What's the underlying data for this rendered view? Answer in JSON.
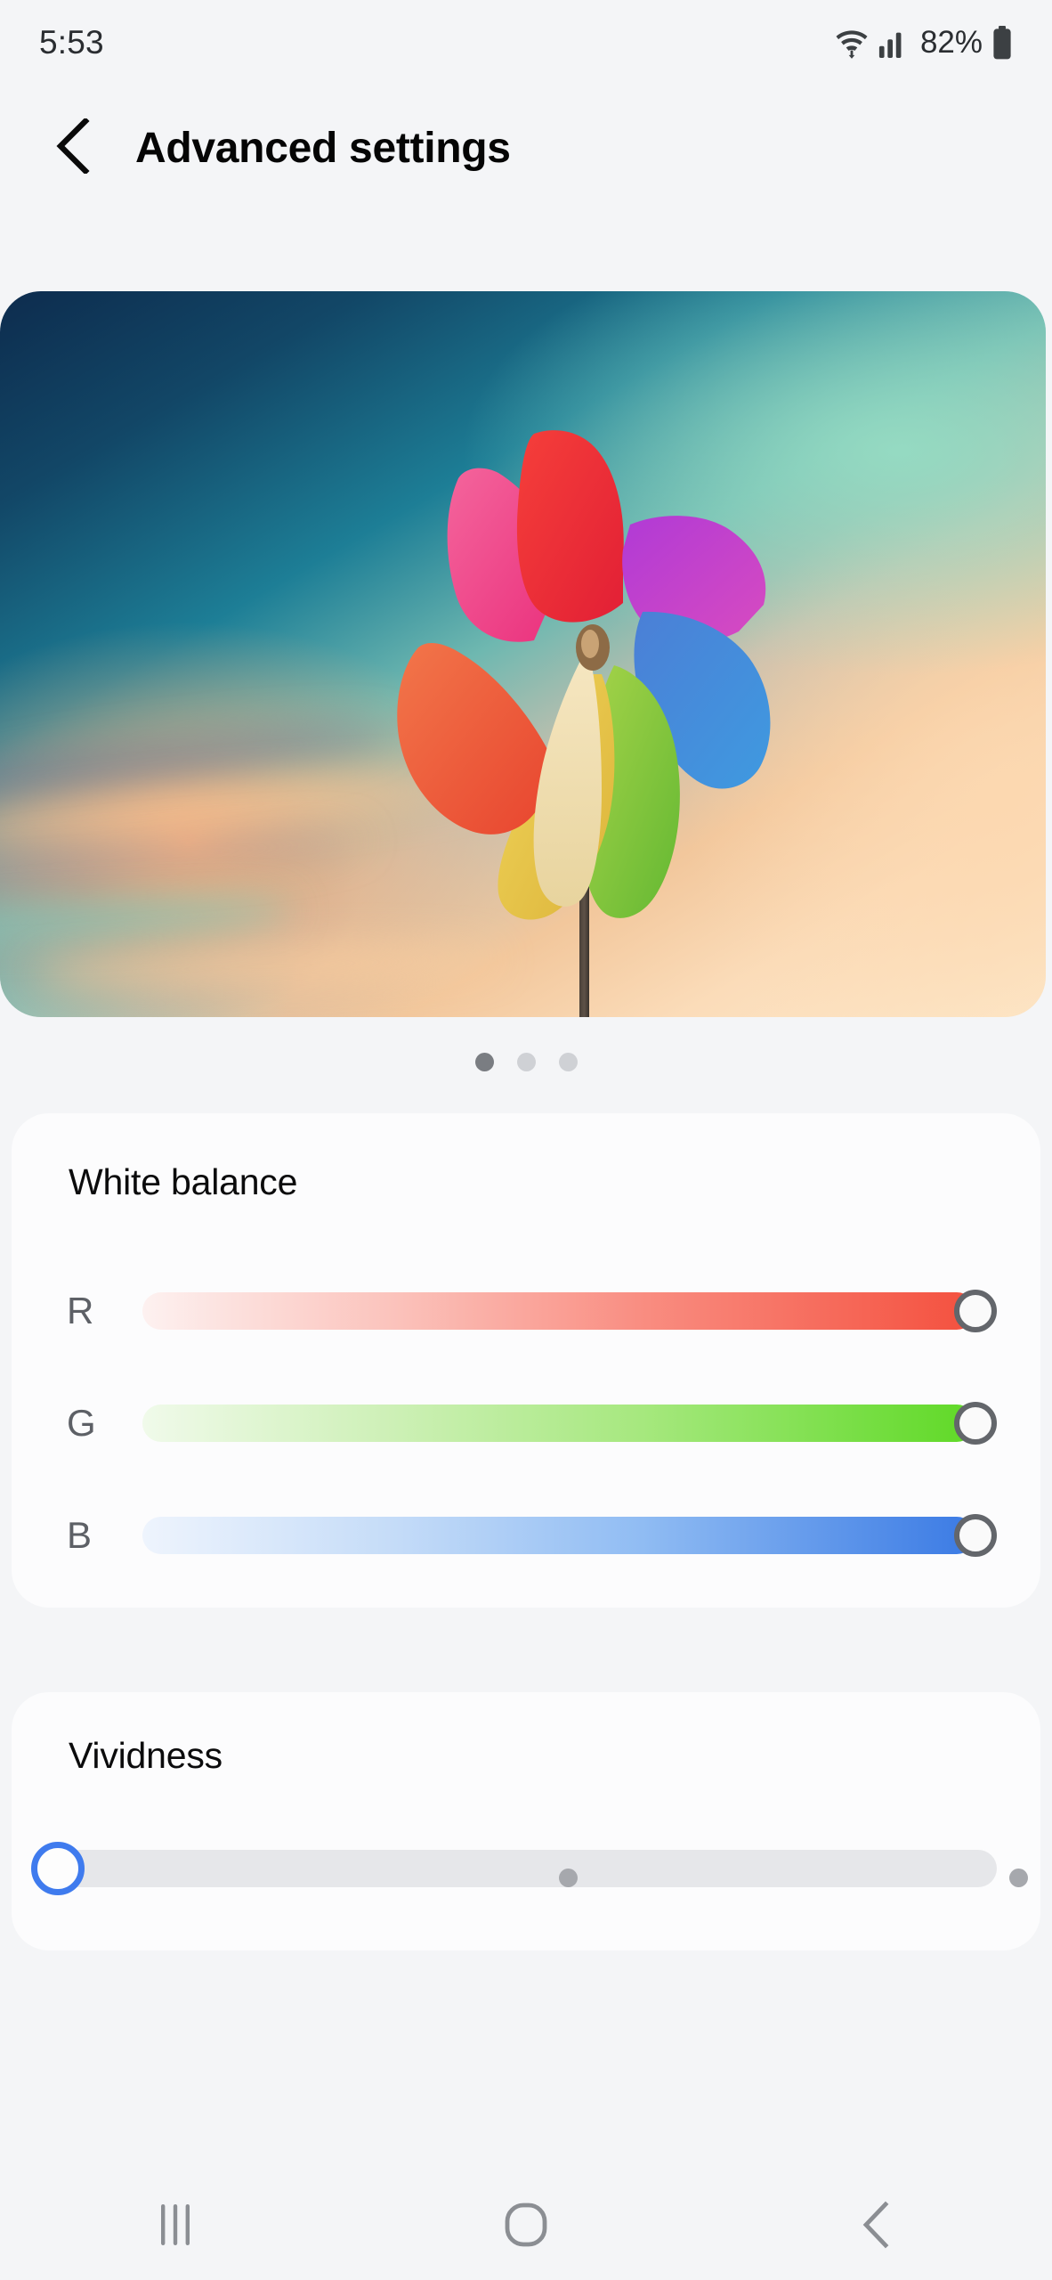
{
  "status_bar": {
    "time": "5:53",
    "battery_text": "82%",
    "icons": [
      "wifi-icon",
      "cellular-signal-icon",
      "battery-icon"
    ]
  },
  "header": {
    "title": "Advanced settings",
    "back_icon": "chevron-left-icon"
  },
  "preview": {
    "alt": "colorful pinwheel against sunset sky",
    "dots": [
      {
        "active": true
      },
      {
        "active": false
      },
      {
        "active": false
      }
    ],
    "active_index": 0,
    "total_pages": 3
  },
  "white_balance": {
    "title": "White balance",
    "sliders": [
      {
        "label": "R",
        "value": 100,
        "min": 0,
        "max": 100,
        "color": "#f4503e"
      },
      {
        "label": "G",
        "value": 100,
        "min": 0,
        "max": 100,
        "color": "#5fd926"
      },
      {
        "label": "B",
        "value": 100,
        "min": 0,
        "max": 100,
        "color": "#3a7ae4"
      }
    ]
  },
  "vividness": {
    "title": "Vividness",
    "value": 0,
    "min": 0,
    "max": 2,
    "steps": 3,
    "thumb_color": "#3f7bee",
    "track_color": "#e6e7ea",
    "tick_color": "#a6a8ad"
  },
  "nav_bar": {
    "buttons": [
      {
        "name": "recents-icon",
        "label": "Recents"
      },
      {
        "name": "home-icon",
        "label": "Home"
      },
      {
        "name": "back-icon",
        "label": "Back"
      }
    ]
  },
  "colors": {
    "page_background": "#f4f5f7",
    "card_background": "#fcfcfd",
    "text_primary": "#050505",
    "text_secondary": "#5d6066",
    "accent_blue": "#3f7bee"
  }
}
